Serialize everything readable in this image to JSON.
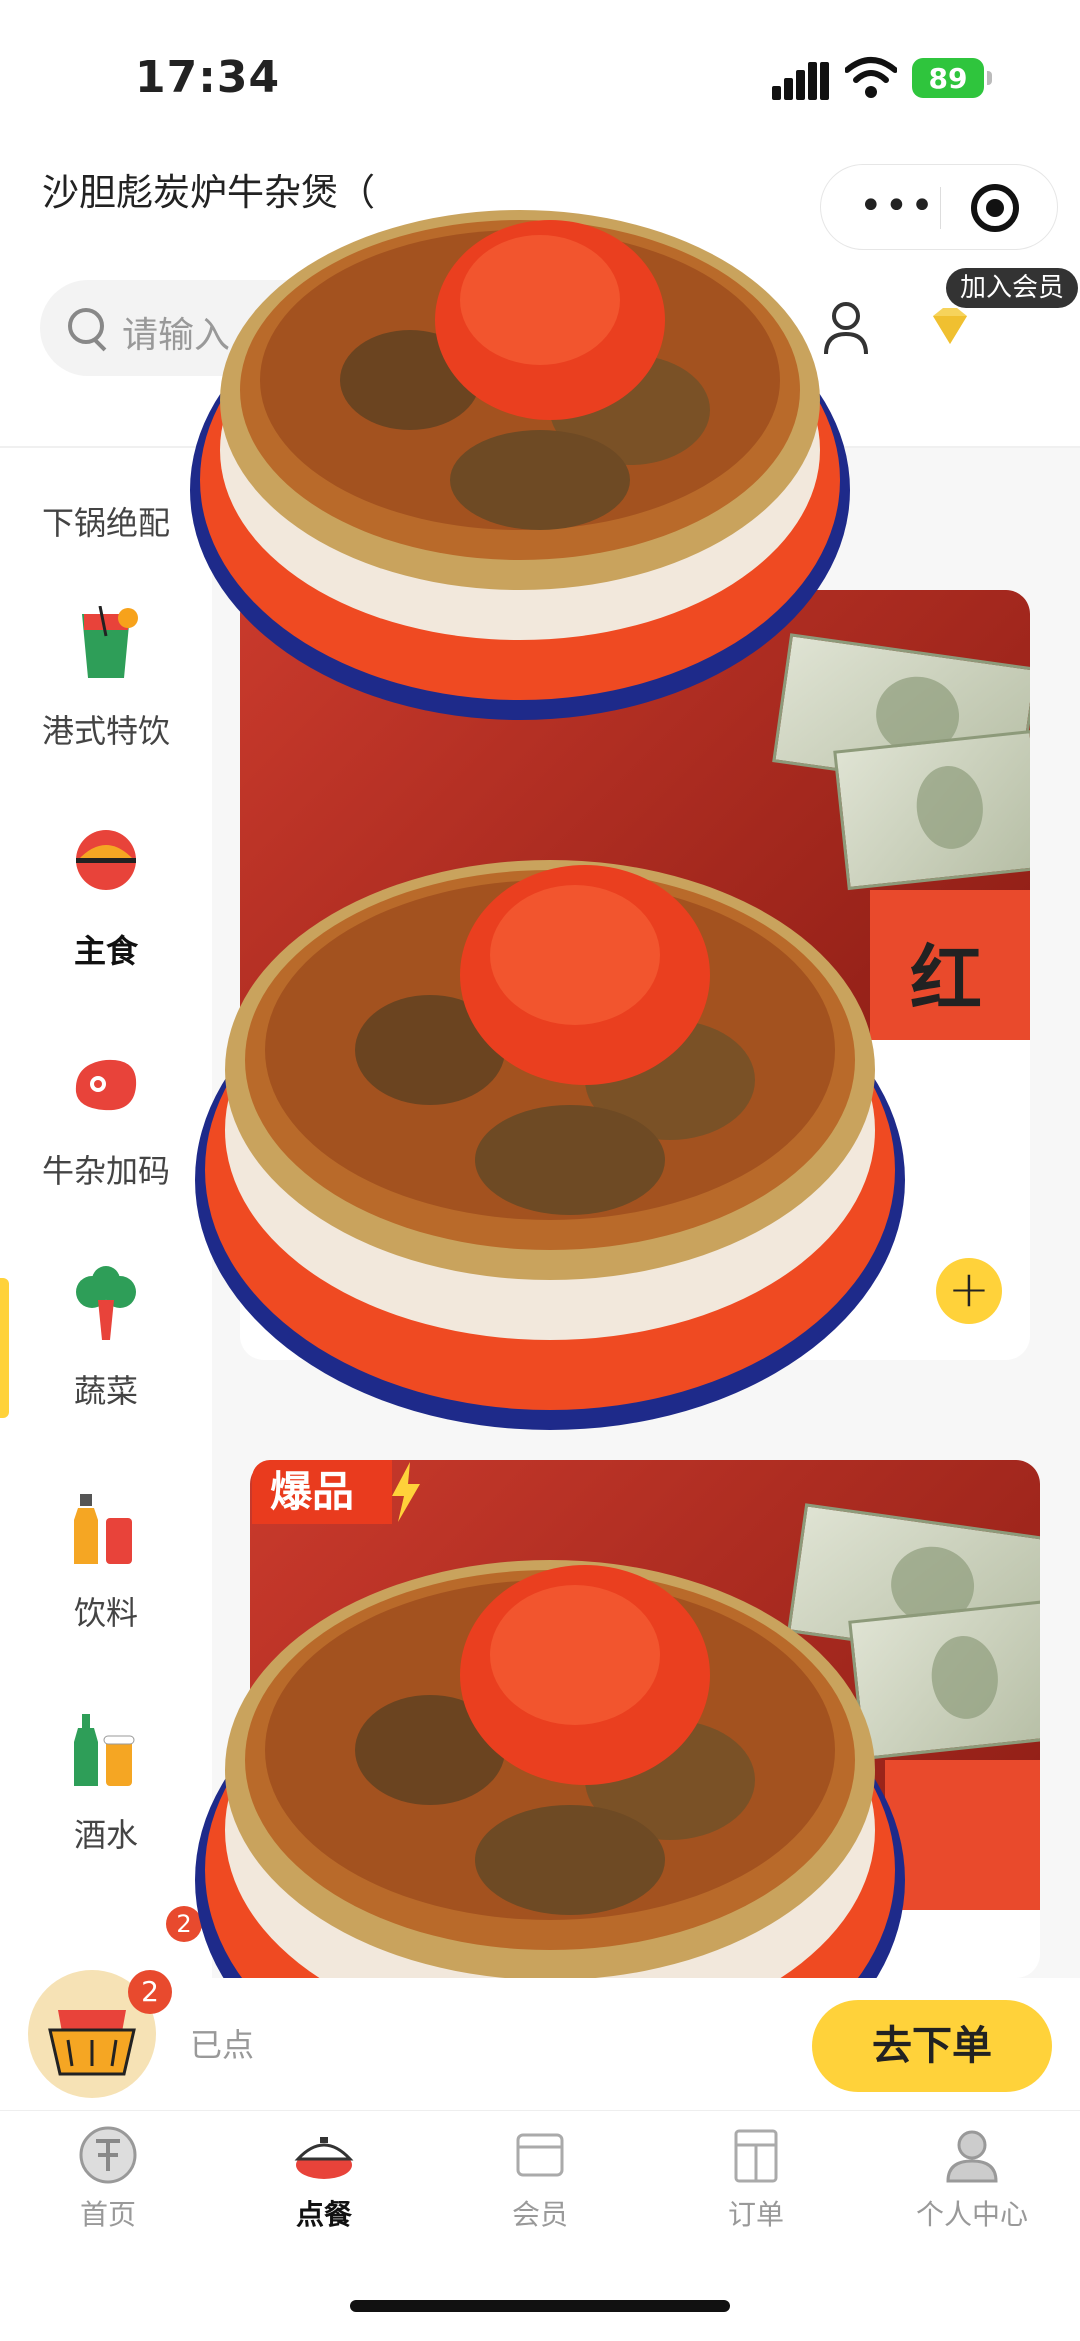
{
  "status": {
    "time": "17:34",
    "battery": "89"
  },
  "header": {
    "store_name": "沙胆彪炭炉牛杂煲（"
  },
  "search": {
    "placeholder": "请输入"
  },
  "member_tip": "加入会员",
  "categories": [
    {
      "label": "下锅绝配",
      "icon": "hotpot-side-icon"
    },
    {
      "label": "港式特饮",
      "icon": "drink-cup-icon"
    },
    {
      "label": "主食",
      "icon": "rice-bowl-icon",
      "active": true
    },
    {
      "label": "牛杂加码",
      "icon": "steak-icon"
    },
    {
      "label": "蔬菜",
      "icon": "broccoli-icon"
    },
    {
      "label": "饮料",
      "icon": "bottle-can-icon"
    },
    {
      "label": "酒水",
      "icon": "beer-icon"
    }
  ],
  "cards": {
    "hot_label": "爆品",
    "red_envelope_text": "红"
  },
  "cart": {
    "count": "2",
    "summary": "已点",
    "checkout_label": "去下单"
  },
  "side_badge": "2",
  "tabs": [
    {
      "label": "首页",
      "icon": "brand-logo-icon"
    },
    {
      "label": "点餐",
      "icon": "pot-icon",
      "active": true
    },
    {
      "label": "会员",
      "icon": "member-card-icon"
    },
    {
      "label": "订单",
      "icon": "order-list-icon"
    },
    {
      "label": "个人中心",
      "icon": "profile-icon"
    }
  ],
  "colors": {
    "accent": "#ffd23a",
    "badge": "#e84a2e",
    "battery": "#2fc53d"
  }
}
